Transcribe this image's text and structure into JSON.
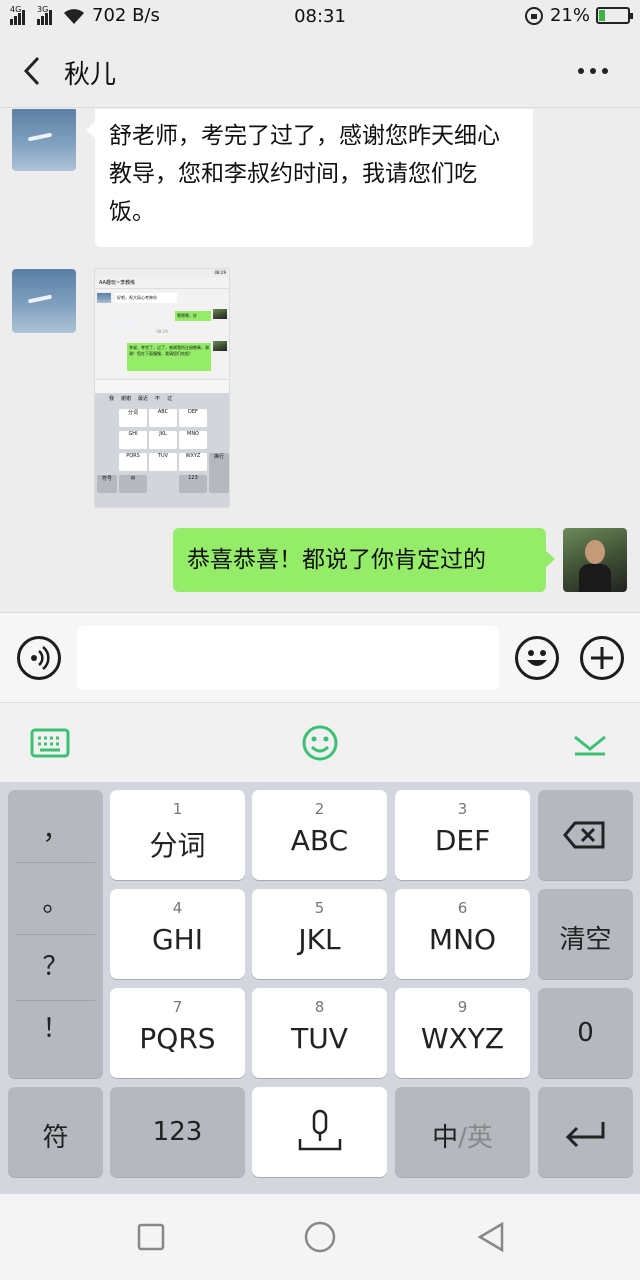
{
  "status_bar": {
    "net1": "4G",
    "net2": "3G",
    "speed": "702 B/s",
    "time": "08:31",
    "battery": "21%",
    "battery_level": 0.21
  },
  "header": {
    "title": "秋儿"
  },
  "messages": [
    {
      "from": "other",
      "type": "text",
      "text": "舒老师，考完了过了，感谢您昨天细心教导，您和李叔约时间，我请您们吃饭。"
    },
    {
      "from": "other",
      "type": "image"
    },
    {
      "from": "me",
      "type": "text",
      "text": "恭喜恭喜！都说了你肯定过的"
    }
  ],
  "embedded_screenshot": {
    "status_time": "08:29",
    "title": "AA趣玩~李教练",
    "msg1": "好吧，祝大局心考神😄",
    "msg2": "嗯嗯嗯，好",
    "time_label": "08:29",
    "msg3": "李叔，考完了，过了，感谢我所注册教奏，谢谢！您在下面慢慢，我请您们吃饭！",
    "candidates": [
      "我",
      "谢谢",
      "最近",
      "不",
      "过"
    ],
    "keys": [
      "分词",
      "ABC",
      "DEF",
      "GHI",
      "JKL",
      "MNO",
      "PQRS",
      "TUV",
      "WXYZ",
      "符号",
      "中",
      "123",
      "换行"
    ]
  },
  "keyboard": {
    "punct": [
      "，",
      "。",
      "？",
      "！"
    ],
    "rows": [
      [
        {
          "num": "1",
          "label": "分词"
        },
        {
          "num": "2",
          "label": "ABC"
        },
        {
          "num": "3",
          "label": "DEF"
        }
      ],
      [
        {
          "num": "4",
          "label": "GHI"
        },
        {
          "num": "5",
          "label": "JKL"
        },
        {
          "num": "6",
          "label": "MNO"
        }
      ],
      [
        {
          "num": "7",
          "label": "PQRS"
        },
        {
          "num": "8",
          "label": "TUV"
        },
        {
          "num": "9",
          "label": "WXYZ"
        }
      ]
    ],
    "clear": "清空",
    "zero": "0",
    "symbol": "符",
    "num_mode": "123",
    "lang_zh": "中",
    "lang_sep": "/",
    "lang_en": "英"
  },
  "colors": {
    "accent_green": "#3cc073",
    "bubble_green": "#95ec69"
  }
}
